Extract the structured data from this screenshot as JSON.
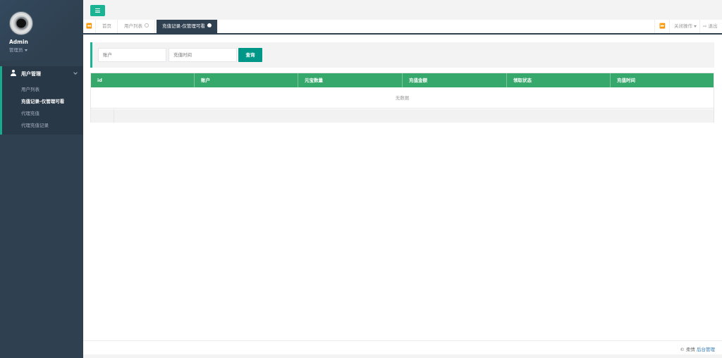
{
  "sidebar": {
    "user": {
      "name": "Admin",
      "role": "管理员"
    },
    "menu_group": {
      "label": "用户管理",
      "items": [
        {
          "label": "用户列表",
          "active": false
        },
        {
          "label": "充值记录-仅管理可看",
          "active": true
        },
        {
          "label": "代理充值",
          "active": false
        },
        {
          "label": "代理充值记录",
          "active": false
        }
      ]
    }
  },
  "tabs": [
    {
      "label": "首页",
      "active": false,
      "closable": false
    },
    {
      "label": "用户列表",
      "active": false,
      "closable": true
    },
    {
      "label": "充值记录-仅管理可看",
      "active": true,
      "closable": true
    }
  ],
  "tab_actions": {
    "close_ops": "关闭操作",
    "logout": "退出"
  },
  "search": {
    "account_placeholder": "账户",
    "time_placeholder": "充值时间",
    "button": "查询"
  },
  "table": {
    "columns": [
      "id",
      "账户",
      "元宝数量",
      "充值金额",
      "领取状态",
      "充值时间"
    ],
    "empty_text": "无数据"
  },
  "footer": {
    "copyright": "© 柔情",
    "link": "后台管理"
  },
  "colors": {
    "accent": "#1ab394",
    "table_header": "#36a86c",
    "sidebar": "#2f4050",
    "button": "#009688"
  }
}
